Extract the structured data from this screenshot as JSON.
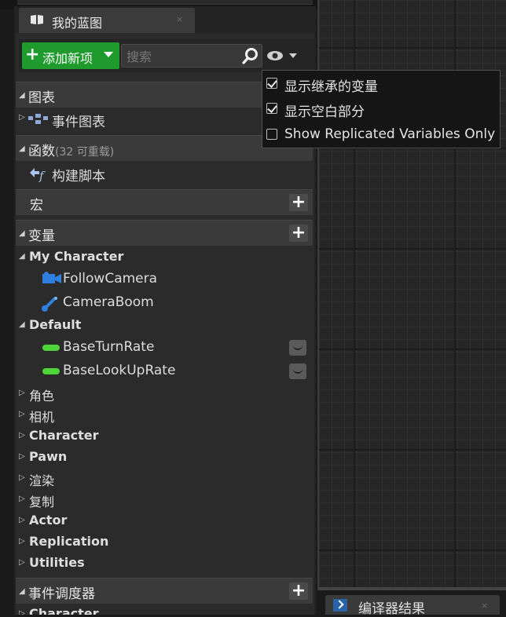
{
  "panel": {
    "tab_label": "我的蓝图",
    "tab_close": "×"
  },
  "toolbar": {
    "add_new_label": "添加新项",
    "search_placeholder": "搜索"
  },
  "sections": {
    "graphs": {
      "label": "图表",
      "items": [
        "事件图表"
      ]
    },
    "functions": {
      "label": "函数",
      "sub": "(32 可重载)",
      "items": [
        "构建脚本"
      ]
    },
    "macros": {
      "label": "宏"
    },
    "variables": {
      "label": "变量",
      "categories": {
        "my_character": {
          "label": "My Character",
          "items": [
            "FollowCamera",
            "CameraBoom"
          ]
        },
        "default": {
          "label": "Default",
          "items": [
            "BaseTurnRate",
            "BaseLookUpRate"
          ]
        },
        "collapsed": [
          "角色",
          "相机",
          "Character",
          "Pawn",
          "渲染",
          "复制",
          "Actor",
          "Replication",
          "Utilities"
        ]
      }
    },
    "dispatchers": {
      "label": "事件调度器",
      "items": [
        "Character"
      ]
    }
  },
  "view_menu": {
    "items": [
      {
        "label": "显示继承的变量",
        "checked": true
      },
      {
        "label": "显示空白部分",
        "checked": true
      },
      {
        "label": "Show Replicated Variables Only",
        "checked": false
      }
    ]
  },
  "compiler_tab": {
    "label": "编译器结果",
    "close": "×"
  },
  "colors": {
    "accent_green": "#1f9b2d",
    "variable_pill": "#4fd43a",
    "compiler_icon": "#2a62a6"
  }
}
